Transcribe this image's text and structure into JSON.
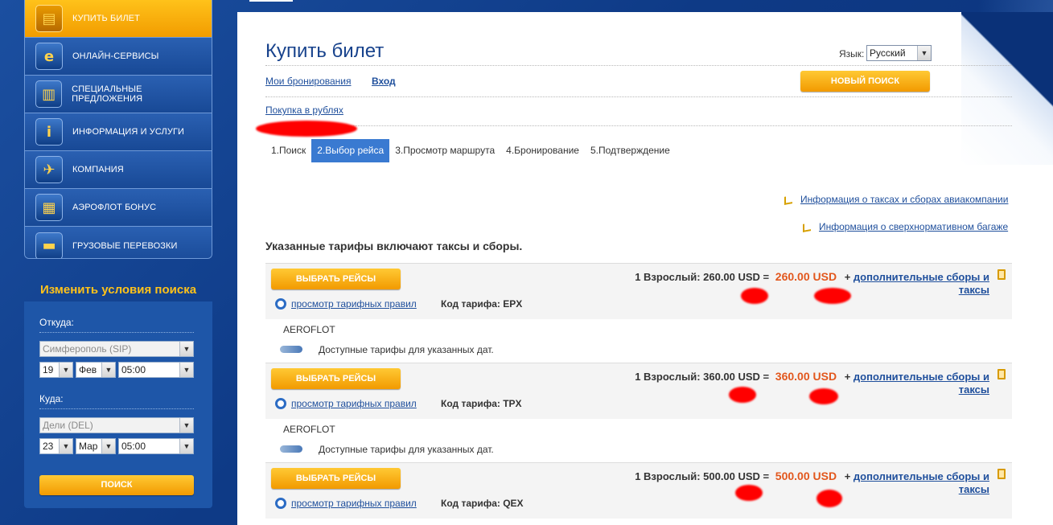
{
  "colors": {
    "page_bg": "#14448f",
    "accent_yellow": "#f7b000",
    "link_blue": "#1f4f9c",
    "price_orange": "#e2571d",
    "step_active": "#3a7ad1"
  },
  "sidebar": {
    "menu": [
      {
        "label": "Купить билет",
        "icon": "ticket-icon",
        "glyph": "▤",
        "active": true
      },
      {
        "label": "Онлайн-сервисы",
        "icon": "internet-icon",
        "glyph": "e",
        "active": false
      },
      {
        "label": "Специальные предложения",
        "icon": "gift-tickets-icon",
        "glyph": "▥",
        "active": false
      },
      {
        "label": "Информация и услуги",
        "icon": "info-icon",
        "glyph": "i",
        "active": false
      },
      {
        "label": "Компания",
        "icon": "airplane-card-icon",
        "glyph": "✈",
        "active": false
      },
      {
        "label": "Аэрофлот бонус",
        "icon": "bonus-gift-icon",
        "glyph": "▦",
        "active": false
      },
      {
        "label": "Грузовые перевозки",
        "icon": "cargo-icon",
        "glyph": "▬",
        "active": false
      }
    ],
    "search": {
      "title": "Изменить условия поиска",
      "from_label": "Откуда:",
      "from_value": "Симферополь (SIP)",
      "from_day": "19",
      "from_month": "Фев",
      "from_time": "05:00",
      "to_label": "Куда:",
      "to_value": "Дели (DEL)",
      "to_day": "23",
      "to_month": "Мар",
      "to_time": "05:00",
      "search_button": "ПОИСК"
    }
  },
  "header": {
    "title": "Купить билет",
    "lang_label": "Язык:",
    "lang_value": "Русский",
    "my_bookings": "Мои бронирования",
    "login": "Вход",
    "new_search": "НОВЫЙ ПОИСК",
    "currency_link": "Покупка в рублях"
  },
  "steps": [
    {
      "label": "1.Поиск",
      "active": false
    },
    {
      "label": "2.Выбор рейса",
      "active": true
    },
    {
      "label": "3.Просмотр маршрута",
      "active": false
    },
    {
      "label": "4.Бронирование",
      "active": false
    },
    {
      "label": "5.Подтверждение",
      "active": false
    }
  ],
  "info_links": {
    "taxes": "Информация о таксах и сборах авиакомпании",
    "baggage": "Информация о сверхнормативном багаже"
  },
  "tariff_note": "Указанные тарифы включают таксы и сборы.",
  "fares": [
    {
      "select_label": "ВЫБРАТЬ РЕЙСЫ",
      "passenger_text": "1 Взрослый: 260.00 USD =",
      "price": "260.00 USD",
      "plus": "+",
      "extra_line1": "дополнительные сборы и",
      "extra_line2": "таксы",
      "rules_link": "просмотр тарифных правил",
      "code_text": "Код тарифа: EPX",
      "carrier": "AEROFLOT",
      "availability": "Доступные тарифы для указанных дат."
    },
    {
      "select_label": "ВЫБРАТЬ РЕЙСЫ",
      "passenger_text": "1 Взрослый: 360.00 USD =",
      "price": "360.00 USD",
      "plus": "+",
      "extra_line1": "дополнительные сборы и",
      "extra_line2": "таксы",
      "rules_link": "просмотр тарифных правил",
      "code_text": "Код тарифа: TPX",
      "carrier": "AEROFLOT",
      "availability": "Доступные тарифы для указанных дат."
    },
    {
      "select_label": "ВЫБРАТЬ РЕЙСЫ",
      "passenger_text": "1 Взрослый: 500.00 USD =",
      "price": "500.00 USD",
      "plus": "+",
      "extra_line1": "дополнительные сборы и",
      "extra_line2": "таксы",
      "rules_link": "просмотр тарифных правил",
      "code_text": "Код тарифа: QEX"
    }
  ]
}
